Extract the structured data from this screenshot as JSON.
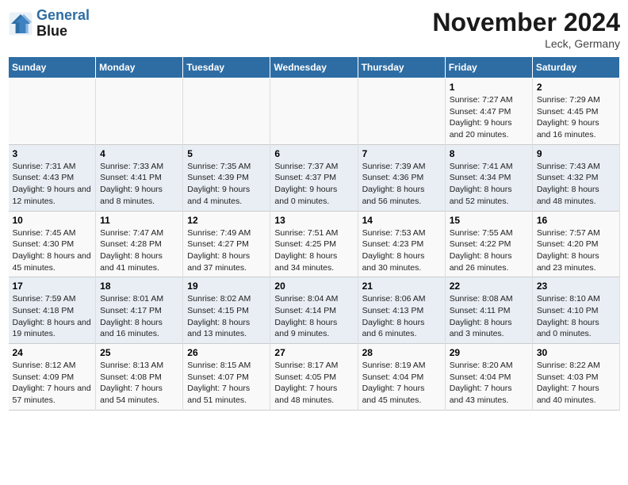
{
  "header": {
    "logo_line1": "General",
    "logo_line2": "Blue",
    "month_title": "November 2024",
    "location": "Leck, Germany"
  },
  "weekdays": [
    "Sunday",
    "Monday",
    "Tuesday",
    "Wednesday",
    "Thursday",
    "Friday",
    "Saturday"
  ],
  "weeks": [
    [
      {
        "day": "",
        "info": ""
      },
      {
        "day": "",
        "info": ""
      },
      {
        "day": "",
        "info": ""
      },
      {
        "day": "",
        "info": ""
      },
      {
        "day": "",
        "info": ""
      },
      {
        "day": "1",
        "info": "Sunrise: 7:27 AM\nSunset: 4:47 PM\nDaylight: 9 hours and 20 minutes."
      },
      {
        "day": "2",
        "info": "Sunrise: 7:29 AM\nSunset: 4:45 PM\nDaylight: 9 hours and 16 minutes."
      }
    ],
    [
      {
        "day": "3",
        "info": "Sunrise: 7:31 AM\nSunset: 4:43 PM\nDaylight: 9 hours and 12 minutes."
      },
      {
        "day": "4",
        "info": "Sunrise: 7:33 AM\nSunset: 4:41 PM\nDaylight: 9 hours and 8 minutes."
      },
      {
        "day": "5",
        "info": "Sunrise: 7:35 AM\nSunset: 4:39 PM\nDaylight: 9 hours and 4 minutes."
      },
      {
        "day": "6",
        "info": "Sunrise: 7:37 AM\nSunset: 4:37 PM\nDaylight: 9 hours and 0 minutes."
      },
      {
        "day": "7",
        "info": "Sunrise: 7:39 AM\nSunset: 4:36 PM\nDaylight: 8 hours and 56 minutes."
      },
      {
        "day": "8",
        "info": "Sunrise: 7:41 AM\nSunset: 4:34 PM\nDaylight: 8 hours and 52 minutes."
      },
      {
        "day": "9",
        "info": "Sunrise: 7:43 AM\nSunset: 4:32 PM\nDaylight: 8 hours and 48 minutes."
      }
    ],
    [
      {
        "day": "10",
        "info": "Sunrise: 7:45 AM\nSunset: 4:30 PM\nDaylight: 8 hours and 45 minutes."
      },
      {
        "day": "11",
        "info": "Sunrise: 7:47 AM\nSunset: 4:28 PM\nDaylight: 8 hours and 41 minutes."
      },
      {
        "day": "12",
        "info": "Sunrise: 7:49 AM\nSunset: 4:27 PM\nDaylight: 8 hours and 37 minutes."
      },
      {
        "day": "13",
        "info": "Sunrise: 7:51 AM\nSunset: 4:25 PM\nDaylight: 8 hours and 34 minutes."
      },
      {
        "day": "14",
        "info": "Sunrise: 7:53 AM\nSunset: 4:23 PM\nDaylight: 8 hours and 30 minutes."
      },
      {
        "day": "15",
        "info": "Sunrise: 7:55 AM\nSunset: 4:22 PM\nDaylight: 8 hours and 26 minutes."
      },
      {
        "day": "16",
        "info": "Sunrise: 7:57 AM\nSunset: 4:20 PM\nDaylight: 8 hours and 23 minutes."
      }
    ],
    [
      {
        "day": "17",
        "info": "Sunrise: 7:59 AM\nSunset: 4:18 PM\nDaylight: 8 hours and 19 minutes."
      },
      {
        "day": "18",
        "info": "Sunrise: 8:01 AM\nSunset: 4:17 PM\nDaylight: 8 hours and 16 minutes."
      },
      {
        "day": "19",
        "info": "Sunrise: 8:02 AM\nSunset: 4:15 PM\nDaylight: 8 hours and 13 minutes."
      },
      {
        "day": "20",
        "info": "Sunrise: 8:04 AM\nSunset: 4:14 PM\nDaylight: 8 hours and 9 minutes."
      },
      {
        "day": "21",
        "info": "Sunrise: 8:06 AM\nSunset: 4:13 PM\nDaylight: 8 hours and 6 minutes."
      },
      {
        "day": "22",
        "info": "Sunrise: 8:08 AM\nSunset: 4:11 PM\nDaylight: 8 hours and 3 minutes."
      },
      {
        "day": "23",
        "info": "Sunrise: 8:10 AM\nSunset: 4:10 PM\nDaylight: 8 hours and 0 minutes."
      }
    ],
    [
      {
        "day": "24",
        "info": "Sunrise: 8:12 AM\nSunset: 4:09 PM\nDaylight: 7 hours and 57 minutes."
      },
      {
        "day": "25",
        "info": "Sunrise: 8:13 AM\nSunset: 4:08 PM\nDaylight: 7 hours and 54 minutes."
      },
      {
        "day": "26",
        "info": "Sunrise: 8:15 AM\nSunset: 4:07 PM\nDaylight: 7 hours and 51 minutes."
      },
      {
        "day": "27",
        "info": "Sunrise: 8:17 AM\nSunset: 4:05 PM\nDaylight: 7 hours and 48 minutes."
      },
      {
        "day": "28",
        "info": "Sunrise: 8:19 AM\nSunset: 4:04 PM\nDaylight: 7 hours and 45 minutes."
      },
      {
        "day": "29",
        "info": "Sunrise: 8:20 AM\nSunset: 4:04 PM\nDaylight: 7 hours and 43 minutes."
      },
      {
        "day": "30",
        "info": "Sunrise: 8:22 AM\nSunset: 4:03 PM\nDaylight: 7 hours and 40 minutes."
      }
    ]
  ]
}
